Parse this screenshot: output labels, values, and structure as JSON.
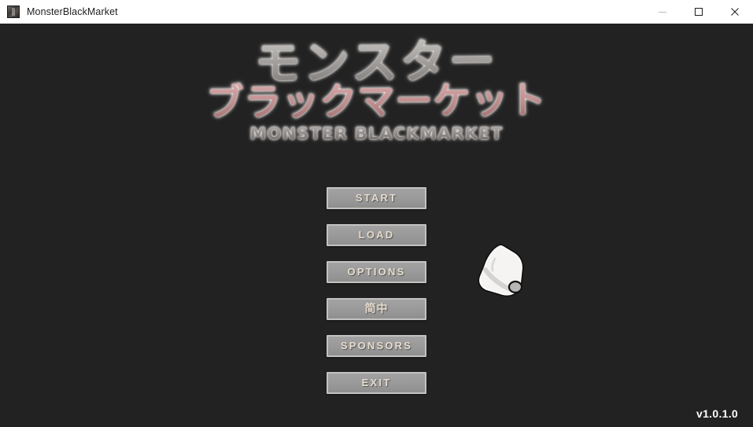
{
  "window": {
    "title": "MonsterBlackMarket",
    "icon": "app-icon",
    "controls": {
      "minimize": "minimize-icon",
      "maximize": "maximize-icon",
      "close": "close-icon"
    }
  },
  "title_screen": {
    "logo": {
      "line1": "モンスター",
      "line2": "ブラックマーケット",
      "subtitle": "MONSTER BLACKMARKET",
      "line1_color": "#a3a09d",
      "line2_color": "#c08f8f",
      "subtitle_color": "#8b8785"
    },
    "menu": {
      "buttons": [
        {
          "id": "start",
          "label": "START"
        },
        {
          "id": "load",
          "label": "LOAD"
        },
        {
          "id": "options",
          "label": "OPTIONS"
        },
        {
          "id": "language",
          "label": "简中"
        },
        {
          "id": "sponsors",
          "label": "SPONSORS"
        },
        {
          "id": "exit",
          "label": "EXIT"
        }
      ],
      "button_face_color": "#9a9a9a",
      "button_border_color": "#c4c2c0",
      "button_text_color": "#e6dbcd"
    },
    "cursor": {
      "icon": "pointing-hand-cursor"
    },
    "version": "v1.0.1.0",
    "background_color": "#222222"
  }
}
